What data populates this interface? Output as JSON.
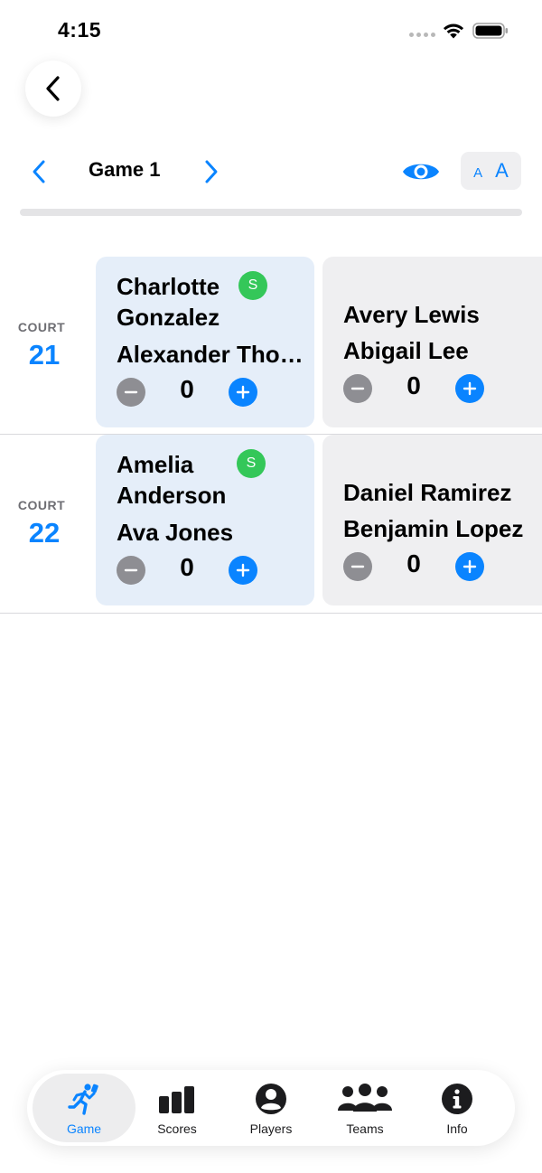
{
  "status_bar": {
    "time": "4:15"
  },
  "header": {
    "back_icon": "chevron-left-icon"
  },
  "game_nav": {
    "title": "Game 1",
    "prev_icon": "chevron-left-icon",
    "next_icon": "chevron-right-icon",
    "visibility_icon": "eye-icon",
    "font_small": "A",
    "font_large": "A"
  },
  "courts": [
    {
      "caption": "COURT",
      "number": "21",
      "teams": [
        {
          "players": [
            "Charlotte Gonzalez",
            "Alexander Thompson"
          ],
          "serving": true,
          "serve_badge": "S",
          "score": "0"
        },
        {
          "players": [
            "Avery Lewis",
            "Abigail Lee"
          ],
          "serving": false,
          "score": "0"
        }
      ]
    },
    {
      "caption": "COURT",
      "number": "22",
      "teams": [
        {
          "players": [
            "Amelia Anderson",
            "Ava Jones"
          ],
          "serving": true,
          "serve_badge": "S",
          "score": "0"
        },
        {
          "players": [
            "Daniel Ramirez",
            "Benjamin Lopez"
          ],
          "serving": false,
          "score": "0"
        }
      ]
    }
  ],
  "display": {
    "court21_left_p1_line1": "Charlotte",
    "court21_left_p1_line2": "Gonzalez",
    "court22_left_p1_line1": "Amelia",
    "court22_left_p1_line2": "Anderson"
  },
  "tabs": [
    {
      "label": "Game",
      "icon": "runner-icon",
      "active": true
    },
    {
      "label": "Scores",
      "icon": "bar-chart-icon",
      "active": false
    },
    {
      "label": "Players",
      "icon": "person-circle-icon",
      "active": false
    },
    {
      "label": "Teams",
      "icon": "people-group-icon",
      "active": false
    },
    {
      "label": "Info",
      "icon": "info-circle-icon",
      "active": false
    }
  ],
  "colors": {
    "accent": "#0a84ff",
    "serve": "#34c759",
    "serving_card": "#e5eef9",
    "card": "#efeff1",
    "minus": "#8e8e93"
  }
}
